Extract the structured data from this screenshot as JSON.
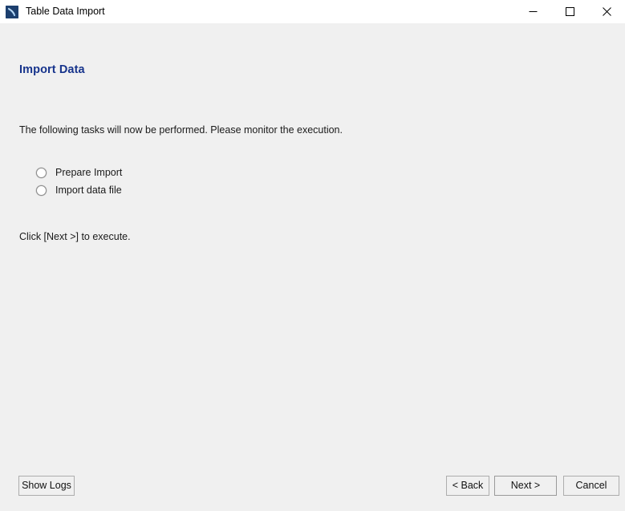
{
  "window": {
    "title": "Table Data Import",
    "app_icon": "mysql-workbench-dolphin-icon",
    "controls": {
      "minimize_label": "Minimize",
      "maximize_label": "Maximize",
      "close_label": "Close"
    }
  },
  "page": {
    "heading": "Import Data",
    "heading_color": "#17348c",
    "intro": "The following tasks will now be performed. Please monitor the execution.",
    "execute_hint": "Click [Next >] to execute."
  },
  "tasks": [
    {
      "label": "Prepare Import",
      "state": "pending"
    },
    {
      "label": "Import data file",
      "state": "pending"
    }
  ],
  "footer": {
    "show_logs_label": "Show Logs",
    "back_label": "< Back",
    "next_label": "Next >",
    "cancel_label": "Cancel"
  }
}
